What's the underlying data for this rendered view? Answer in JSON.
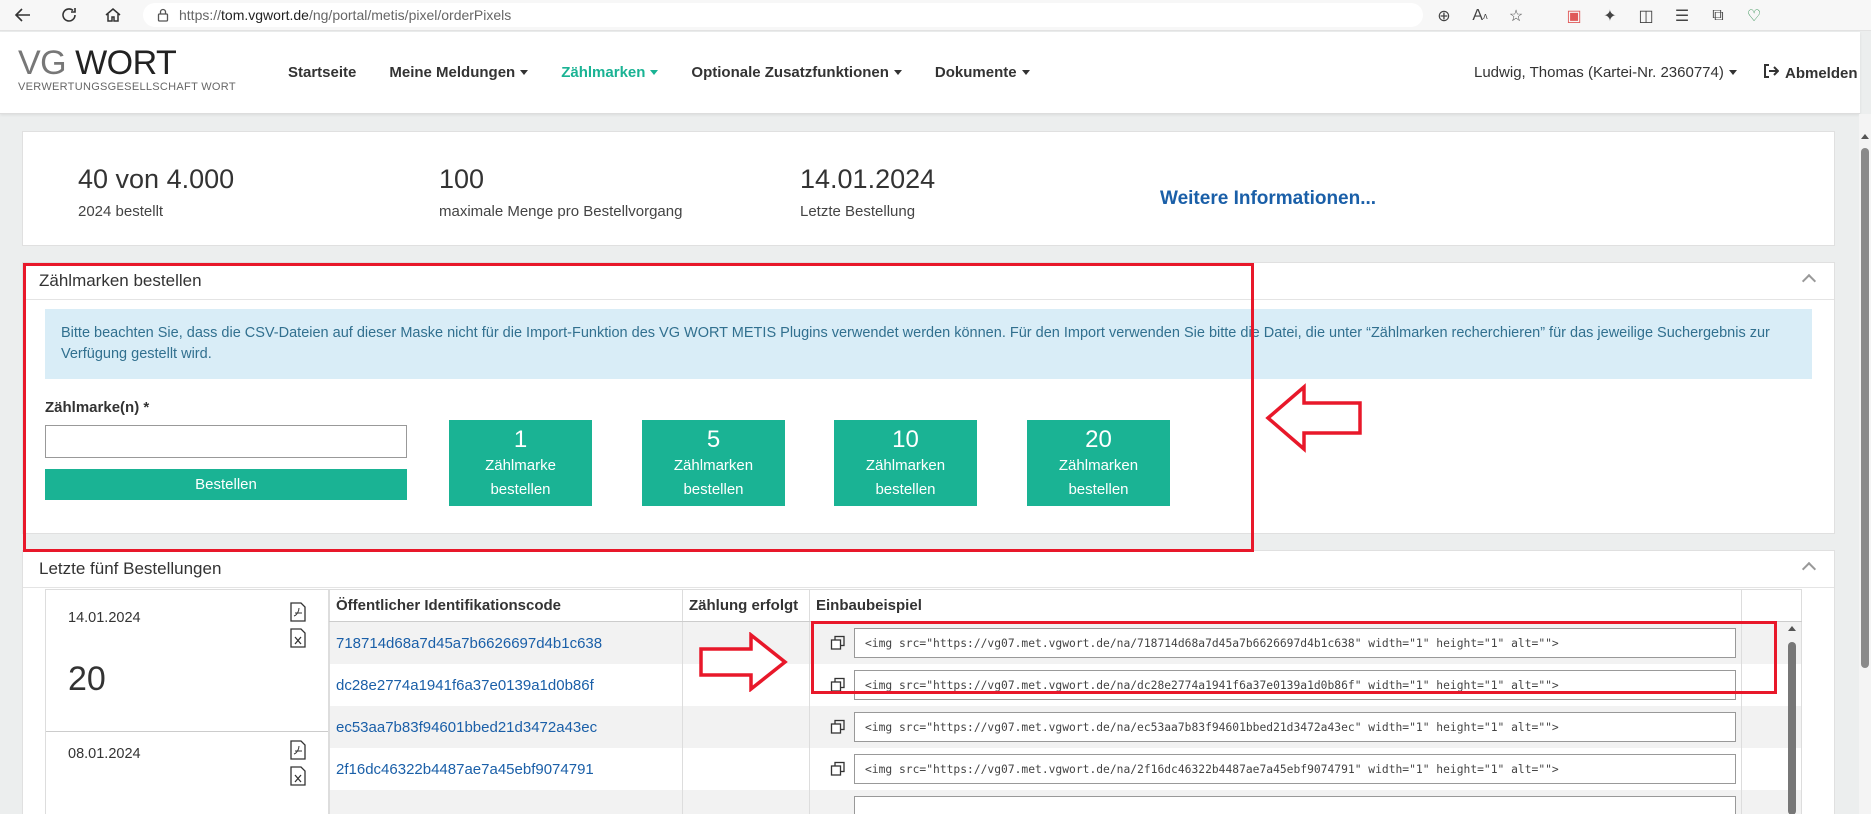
{
  "browser": {
    "url_prefix": "https://",
    "url_host": "tom.vgwort.de",
    "url_path": "/ng/portal/metis/pixel/orderPixels"
  },
  "header": {
    "logo_vg": "VG",
    "logo_wort": "WORT",
    "logo_sub": "VERWERTUNGSGESELLSCHAFT WORT",
    "nav": [
      {
        "label": "Startseite"
      },
      {
        "label": "Meine Meldungen"
      },
      {
        "label": "Zählmarken"
      },
      {
        "label": "Optionale Zusatzfunktionen"
      },
      {
        "label": "Dokumente"
      }
    ],
    "user": "Ludwig, Thomas (Kartei-Nr. 2360774)",
    "logout": "Abmelden",
    "active_color": "#1ab394"
  },
  "stats": {
    "ordered_value": "40 von 4.000",
    "ordered_label": "2024 bestellt",
    "max_value": "100",
    "max_label": "maximale Menge pro Bestellvorgang",
    "last_value": "14.01.2024",
    "last_label": "Letzte Bestellung",
    "more_info": "Weitere Informationen..."
  },
  "order_panel": {
    "title": "Zählmarken bestellen",
    "info": "Bitte beachten Sie, dass die CSV-Dateien auf dieser Maske nicht für die Import-Funktion des VG WORT METIS Plugins verwendet werden können. Für den Import verwenden Sie bitte die Datei, die unter “Zählmarken recherchieren” für das jeweilige Suchergebnis zur Verfügung gestellt wird.",
    "field_label": "Zählmarke(n) *",
    "order_button": "Bestellen",
    "quick": [
      {
        "n": "1",
        "line1": "Zählmarke",
        "line2": "bestellen"
      },
      {
        "n": "5",
        "line1": "Zählmarken",
        "line2": "bestellen"
      },
      {
        "n": "10",
        "line1": "Zählmarken",
        "line2": "bestellen"
      },
      {
        "n": "20",
        "line1": "Zählmarken",
        "line2": "bestellen"
      }
    ]
  },
  "last_orders": {
    "title": "Letzte fünf Bestellungen",
    "orders": [
      {
        "date": "14.01.2024",
        "count": "20"
      },
      {
        "date": "08.01.2024",
        "count": ""
      }
    ],
    "columns": [
      "Öffentlicher Identifikationscode",
      "Zählung erfolgt",
      "Einbaubeispiel",
      ""
    ],
    "rows": [
      {
        "code": "718714d68a7d45a7b6626697d4b1c638",
        "counted": "",
        "snippet": "<img src=\"https://vg07.met.vgwort.de/na/718714d68a7d45a7b6626697d4b1c638\" width=\"1\" height=\"1\" alt=\"\">"
      },
      {
        "code": "dc28e2774a1941f6a37e0139a1d0b86f",
        "counted": "",
        "snippet": "<img src=\"https://vg07.met.vgwort.de/na/dc28e2774a1941f6a37e0139a1d0b86f\" width=\"1\" height=\"1\" alt=\"\">"
      },
      {
        "code": "ec53aa7b83f94601bbed21d3472a43ec",
        "counted": "",
        "snippet": "<img src=\"https://vg07.met.vgwort.de/na/ec53aa7b83f94601bbed21d3472a43ec\" width=\"1\" height=\"1\" alt=\"\">"
      },
      {
        "code": "2f16dc46322b4487ae7a45ebf9074791",
        "counted": "",
        "snippet": "<img src=\"https://vg07.met.vgwort.de/na/2f16dc46322b4487ae7a45ebf9074791\" width=\"1\" height=\"1\" alt=\"\">"
      }
    ]
  },
  "annotation_color": "#e8182a"
}
